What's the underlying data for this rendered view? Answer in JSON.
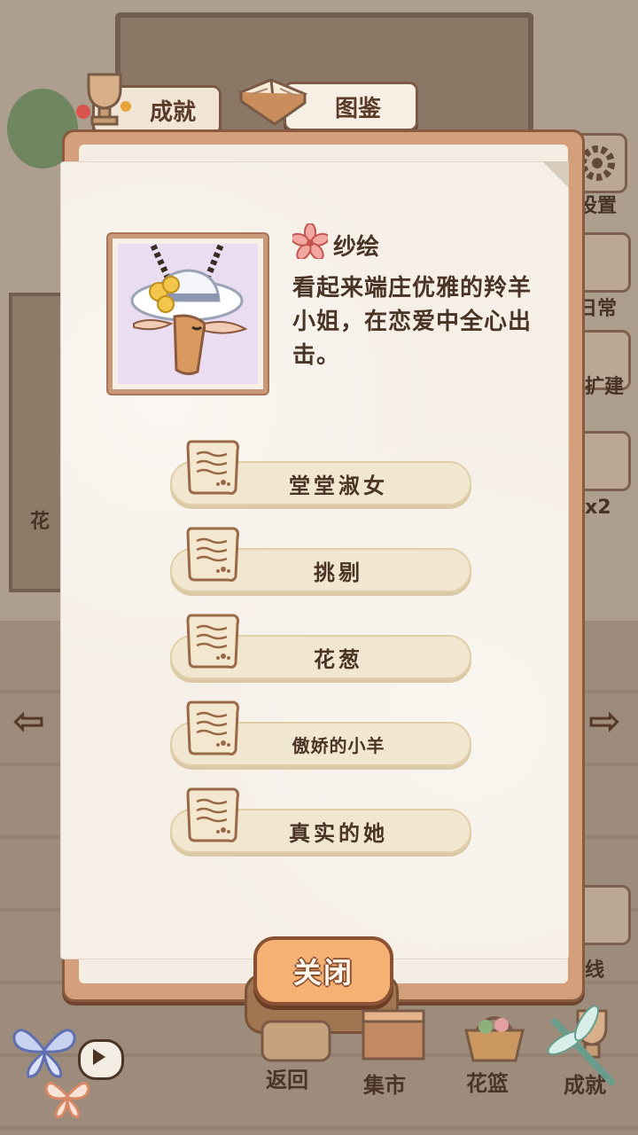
{
  "tabs": {
    "achievement": "成就",
    "codex": "图鉴"
  },
  "side_menu": {
    "settings": "设置",
    "daily": "日常",
    "build": "扩建",
    "multiplier": "x2",
    "flower_shelf": "花",
    "line": "线"
  },
  "character": {
    "name": "纱绘",
    "description": "看起来端庄优雅的羚羊小姐，在恋爱中全心出击。"
  },
  "traits": [
    "堂堂淑女",
    "挑剔",
    "花葱",
    "傲娇的小羊",
    "真实的她"
  ],
  "close_button": "关闭",
  "bottom_nav": {
    "back": "返回",
    "market": "集市",
    "basket": "花篮",
    "achievement": "成就"
  },
  "colors": {
    "panel_border": "#8a5a3e",
    "paper": "#f5efe6",
    "trait_fill": "#f1e6cf",
    "close_fill": "#f5b074",
    "text": "#4a3426"
  }
}
